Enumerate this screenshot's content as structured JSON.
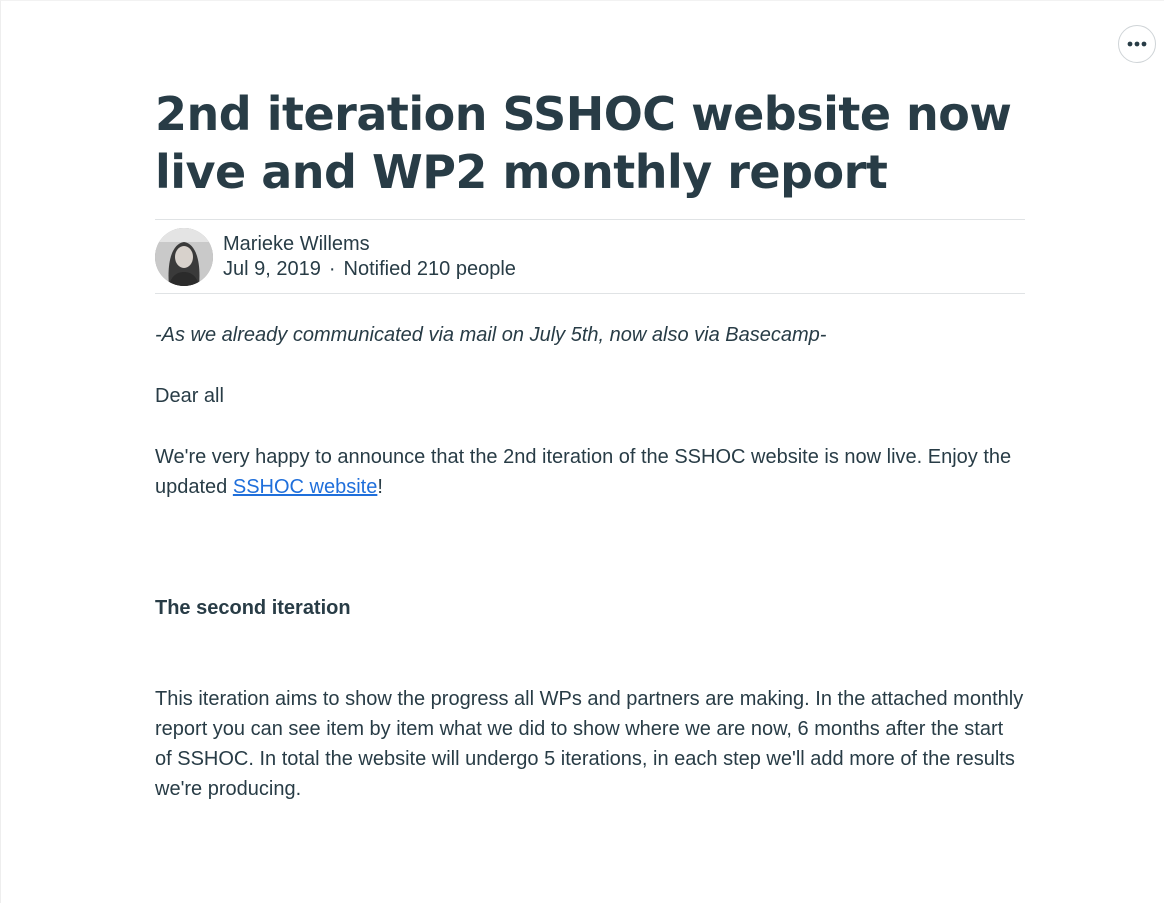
{
  "toolbar": {
    "more_icon": "more-horizontal-icon"
  },
  "message": {
    "title": "2nd iteration SSHOC website now live and WP2 monthly report",
    "author": {
      "name": "Marieke Willems",
      "avatar_icon": "avatar-photo",
      "date": "Jul 9, 2019",
      "separator": "·",
      "notified": "Notified 210 people"
    },
    "intro_note": "-As we already communicated via mail on July 5th, now also via Basecamp-",
    "greeting": "Dear all",
    "announcement_text": "We're very happy to announce that the 2nd iteration of the SSHOC website is now live. Enjoy the updated ",
    "announcement_link": "SSHOC website",
    "announcement_end": "!",
    "section_heading": "The second iteration",
    "iteration_text": "This iteration aims to show the progress all WPs and partners are making. In the attached monthly report you can see item by item what we did to show where we are now, 6 months after the start of SSHOC. In total the website will undergo 5 iterations, in each step we'll add more of the results we're producing."
  },
  "colors": {
    "text": "#283c46",
    "link": "#1f6fdb",
    "divider": "#e0e3e5"
  }
}
